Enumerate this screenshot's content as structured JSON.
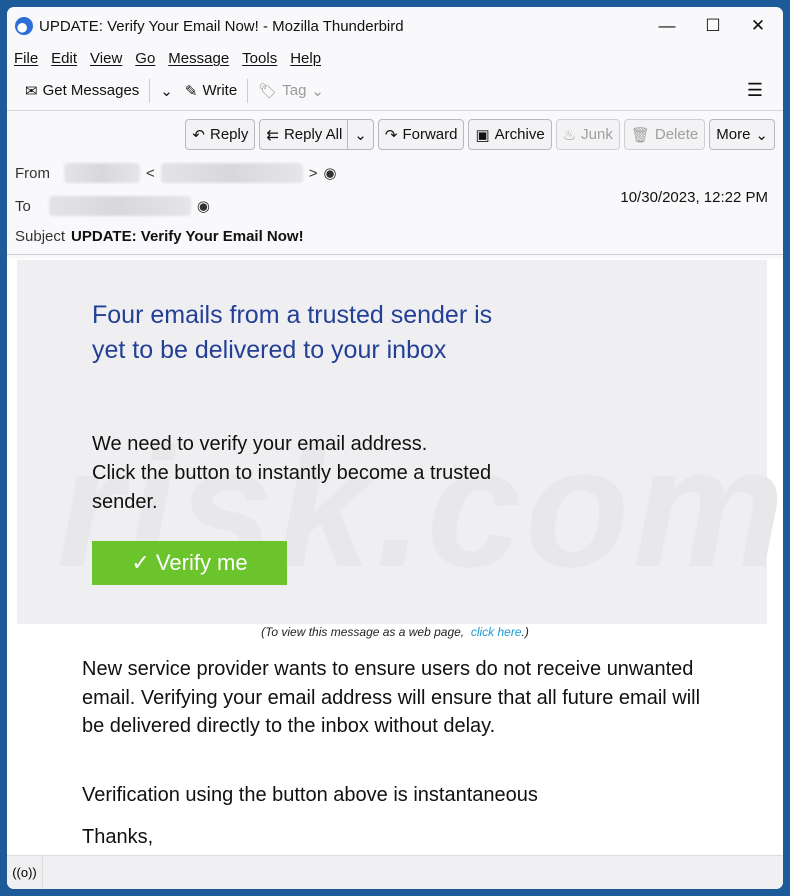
{
  "window": {
    "title": "UPDATE: Verify Your Email Now! - Mozilla Thunderbird",
    "minimize": "—",
    "maximize": "☐",
    "close": "✕"
  },
  "menu": [
    "File",
    "Edit",
    "View",
    "Go",
    "Message",
    "Tools",
    "Help"
  ],
  "toolbar": {
    "get_messages": "Get Messages",
    "write": "Write",
    "tag": "Tag",
    "menu_icon": "☰"
  },
  "actions": {
    "reply": "Reply",
    "reply_all": "Reply All",
    "forward": "Forward",
    "archive": "Archive",
    "junk": "Junk",
    "delete": "Delete",
    "more": "More"
  },
  "header": {
    "from_label": "From",
    "to_label": "To",
    "subject_label": "Subject",
    "subject": "UPDATE: Verify Your Email Now!",
    "date": "10/30/2023, 12:22 PM",
    "lt": "<",
    "gt": ">"
  },
  "email": {
    "headline_1": "Four  emails from a trusted sender is",
    "headline_2": "yet to be delivered to your inbox",
    "p1_1": "We need to verify your email address.",
    "p1_2": "Click the button to instantly become a trusted sender.",
    "button": "✓ Verify me",
    "webview_text": "(To view this message as a web page,",
    "webview_link": "click here",
    "webview_end": ".)",
    "p2": "New service provider wants to ensure users do not receive unwanted email. Verifying your email address will ensure that all future email  will be delivered directly to the inbox without delay.",
    "p3": "Verification using the button above is instantaneous",
    "p4": "Thanks,",
    "watermark": "PC risk.com"
  },
  "colors": {
    "headline": "#233f96",
    "button": "#6cc42c",
    "link": "#1a9ad6",
    "frame": "#1d5a9a"
  }
}
